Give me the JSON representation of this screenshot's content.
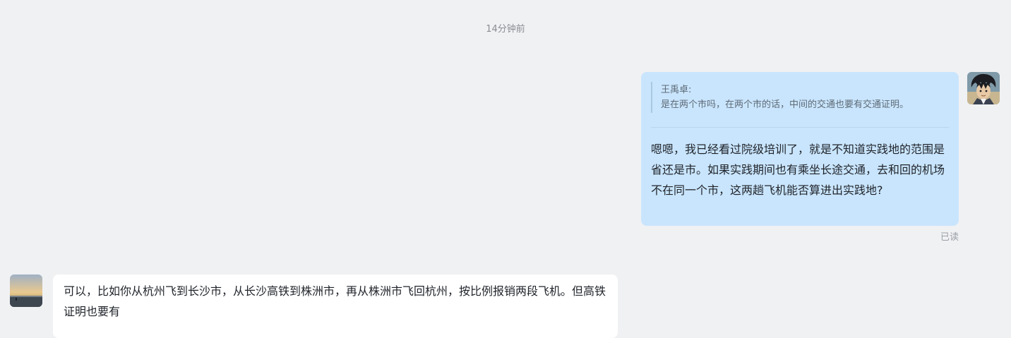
{
  "chat": {
    "timestamp": "14分钟前",
    "outgoing": {
      "quote_author": "王禹卓:",
      "quote_text": "是在两个市吗，在两个市的话，中间的交通也要有交通证明。",
      "text": "嗯嗯，我已经看过院级培训了，就是不知道实践地的范围是省还是市。如果实践期间也有乘坐长途交通，去和回的机场不在同一个市，这两趟飞机能否算进出实践地?",
      "read_status": "已读",
      "bubble_color": "#c9e5fd"
    },
    "incoming": {
      "text": "可以，比如你从杭州飞到长沙市，从长沙高铁到株洲市，再从株洲市飞回杭州，按比例报销两段飞机。但高铁证明也要有",
      "bubble_color": "#ffffff"
    },
    "background_color": "#f0f1f3"
  }
}
